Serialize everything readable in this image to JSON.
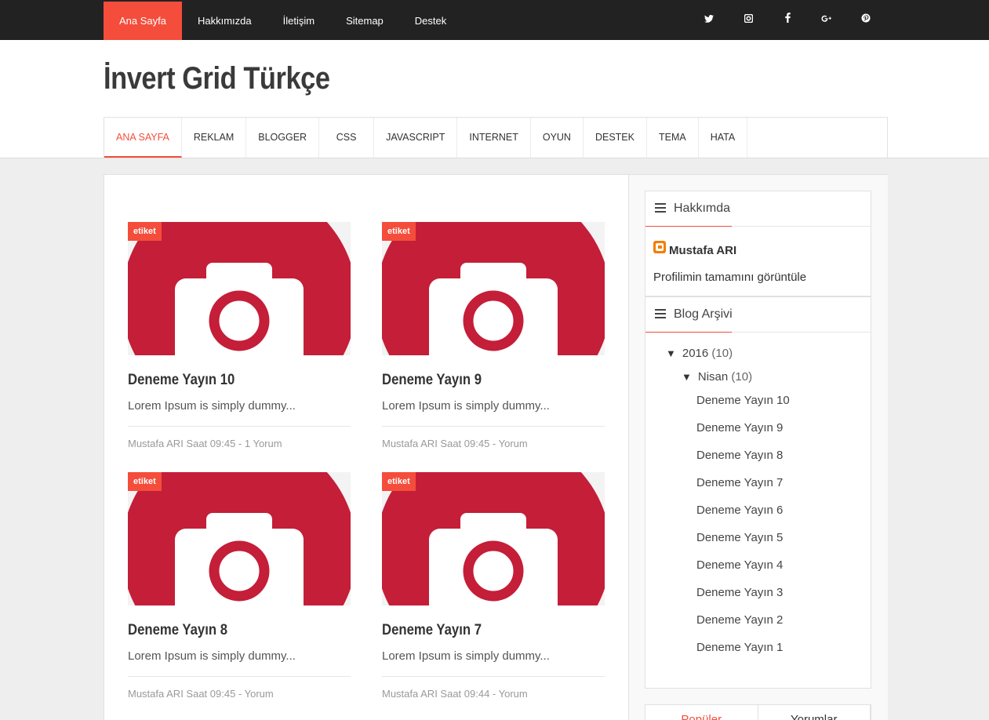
{
  "topbar": {
    "items": [
      {
        "label": "Ana Sayfa",
        "active": true
      },
      {
        "label": "Hakkımızda"
      },
      {
        "label": "İletişim"
      },
      {
        "label": "Sitemap"
      },
      {
        "label": "Destek"
      }
    ],
    "social": [
      {
        "icon": "twitter-icon",
        "glyph": "🐦"
      },
      {
        "icon": "instagram-icon",
        "glyph": "◙"
      },
      {
        "icon": "facebook-icon",
        "glyph": "f"
      },
      {
        "icon": "google-plus-icon",
        "glyph": "g+"
      },
      {
        "icon": "pinterest-icon",
        "glyph": "℗"
      }
    ]
  },
  "site": {
    "title": "İnvert Grid Türkçe"
  },
  "mainnav": [
    {
      "label": "ANA SAYFA",
      "active": true
    },
    {
      "label": "REKLAM"
    },
    {
      "label": "BLOGGER"
    },
    {
      "label": "CSS"
    },
    {
      "label": "JAVASCRIPT"
    },
    {
      "label": "INTERNET"
    },
    {
      "label": "OYUN"
    },
    {
      "label": "DESTEK"
    },
    {
      "label": "TEMA"
    },
    {
      "label": "HATA"
    }
  ],
  "posts": [
    {
      "tag": "etiket",
      "title": "Deneme Yayın 10",
      "snippet": "Lorem Ipsum is simply dummy...",
      "meta": "Mustafa ARI Saat 09:45  -  1 Yorum"
    },
    {
      "tag": "etiket",
      "title": "Deneme Yayın 9",
      "snippet": "Lorem Ipsum is simply dummy...",
      "meta": "Mustafa ARI Saat 09:45  -  Yorum"
    },
    {
      "tag": "etiket",
      "title": "Deneme Yayın 8",
      "snippet": "Lorem Ipsum is simply dummy...",
      "meta": "Mustafa ARI Saat 09:45  -  Yorum"
    },
    {
      "tag": "etiket",
      "title": "Deneme Yayın 7",
      "snippet": "Lorem Ipsum is simply dummy...",
      "meta": "Mustafa ARI Saat 09:44  -  Yorum"
    }
  ],
  "about": {
    "title": "Hakkımda",
    "name": "Mustafa ARI",
    "link": "Profilimin tamamını görüntüle"
  },
  "archive": {
    "title": "Blog Arşivi",
    "year": "2016",
    "year_count": "(10)",
    "month": "Nisan",
    "month_count": "(10)",
    "posts": [
      "Deneme Yayın 10",
      "Deneme Yayın 9",
      "Deneme Yayın 8",
      "Deneme Yayın 7",
      "Deneme Yayın 6",
      "Deneme Yayın 5",
      "Deneme Yayın 4",
      "Deneme Yayın 3",
      "Deneme Yayın 2",
      "Deneme Yayın 1"
    ]
  },
  "tabs": [
    {
      "label": "Popüler",
      "active": true
    },
    {
      "label": "Yorumlar"
    }
  ],
  "colors": {
    "accent": "#f44d3c",
    "topbar": "#222222",
    "thumb": "#c41e38"
  }
}
